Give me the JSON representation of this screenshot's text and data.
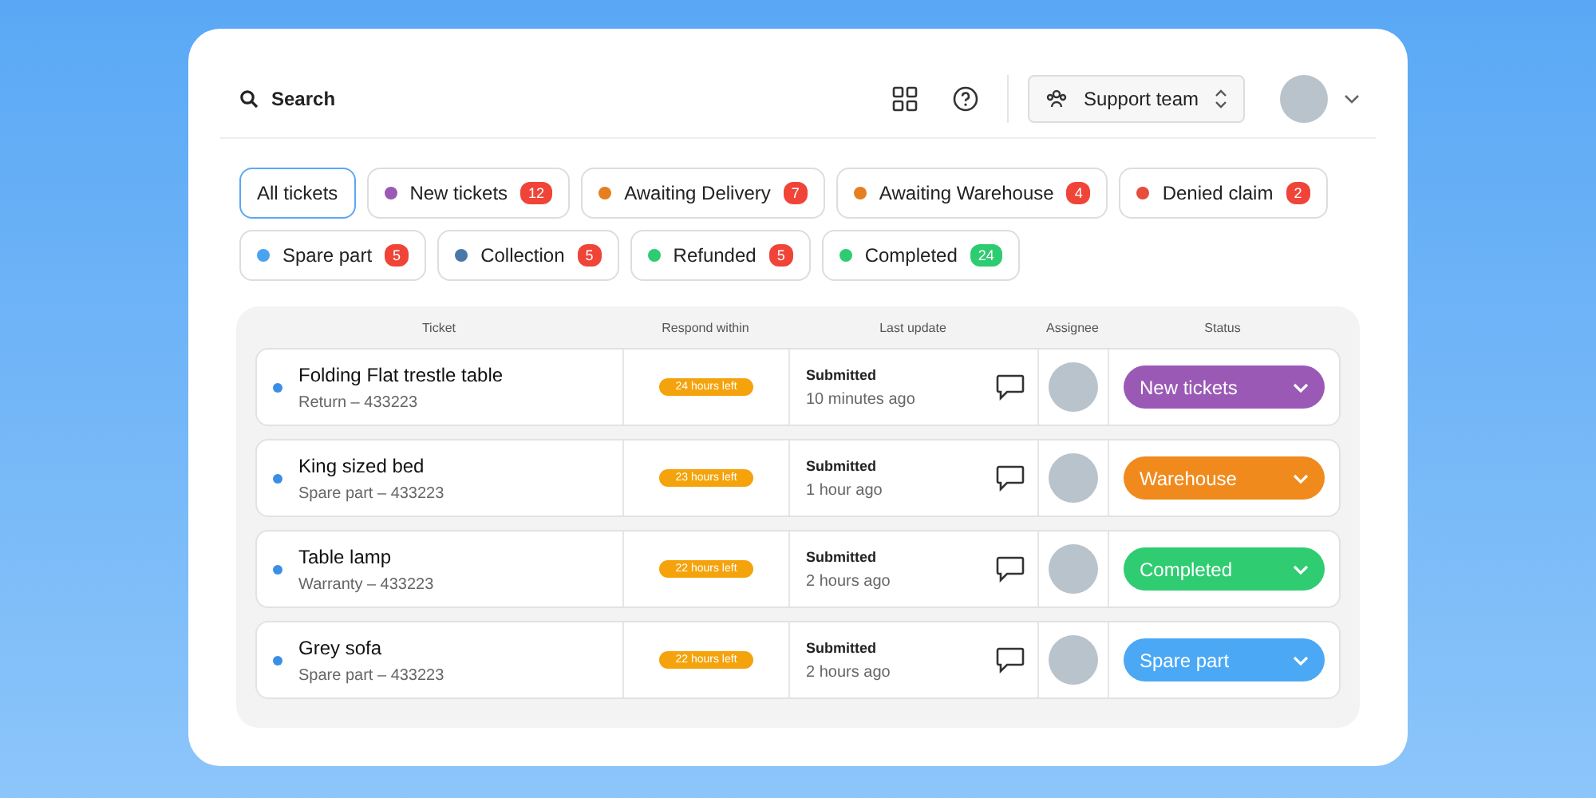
{
  "header": {
    "search": {
      "placeholder": "Search"
    },
    "team_selector": "Support team"
  },
  "filters": [
    {
      "label": "All tickets",
      "selected": true
    },
    {
      "label": "New tickets",
      "selected": false,
      "color": "#9b59b6",
      "count": {
        "text": "12",
        "color": "#f04438"
      }
    },
    {
      "label": "Awaiting Delivery",
      "selected": false,
      "color": "#e67e22",
      "count": {
        "text": "7",
        "color": "#f04438"
      }
    },
    {
      "label": "Awaiting Warehouse",
      "selected": false,
      "color": "#e67e22",
      "count": {
        "text": "4",
        "color": "#f04438"
      }
    },
    {
      "label": "Denied claim",
      "selected": false,
      "color": "#e74c3c",
      "count": {
        "text": "2",
        "color": "#f04438"
      }
    },
    {
      "label": "Spare part",
      "selected": false,
      "color": "#4aa3f0",
      "count": {
        "text": "5",
        "color": "#f04438"
      }
    },
    {
      "label": "Collection",
      "selected": false,
      "color": "#4a78a8",
      "count": {
        "text": "5",
        "color": "#f04438"
      }
    },
    {
      "label": "Refunded",
      "selected": false,
      "color": "#2ecc71",
      "count": {
        "text": "5",
        "color": "#f04438"
      }
    },
    {
      "label": "Completed",
      "selected": false,
      "color": "#2ecc71",
      "count": {
        "text": "24",
        "color": "#2ecc71"
      }
    }
  ],
  "table": {
    "columns": [
      "Ticket",
      "Respond within",
      "Last update",
      "Assignee",
      "Status"
    ],
    "rows": [
      {
        "title": "Folding Flat trestle table",
        "subtitle": "Return – 433223",
        "respond": "24 hours left",
        "update": "Submitted",
        "update_time": "10 minutes ago",
        "status": {
          "label": "New tickets",
          "color": "#9b59b6"
        }
      },
      {
        "title": "King sized bed",
        "subtitle": "Spare part – 433223",
        "respond": "23 hours left",
        "update": "Submitted",
        "update_time": "1 hour ago",
        "status": {
          "label": "Warehouse",
          "color": "#f08a1c"
        }
      },
      {
        "title": "Table lamp",
        "subtitle": "Warranty – 433223",
        "respond": "22 hours left",
        "update": "Submitted",
        "update_time": "2 hours ago",
        "status": {
          "label": "Completed",
          "color": "#2fcc71"
        }
      },
      {
        "title": "Grey sofa",
        "subtitle": "Spare part – 433223",
        "respond": "22 hours left",
        "update": "Submitted",
        "update_time": "2 hours ago",
        "status": {
          "label": "Spare part",
          "color": "#4aa8f5"
        }
      }
    ]
  }
}
